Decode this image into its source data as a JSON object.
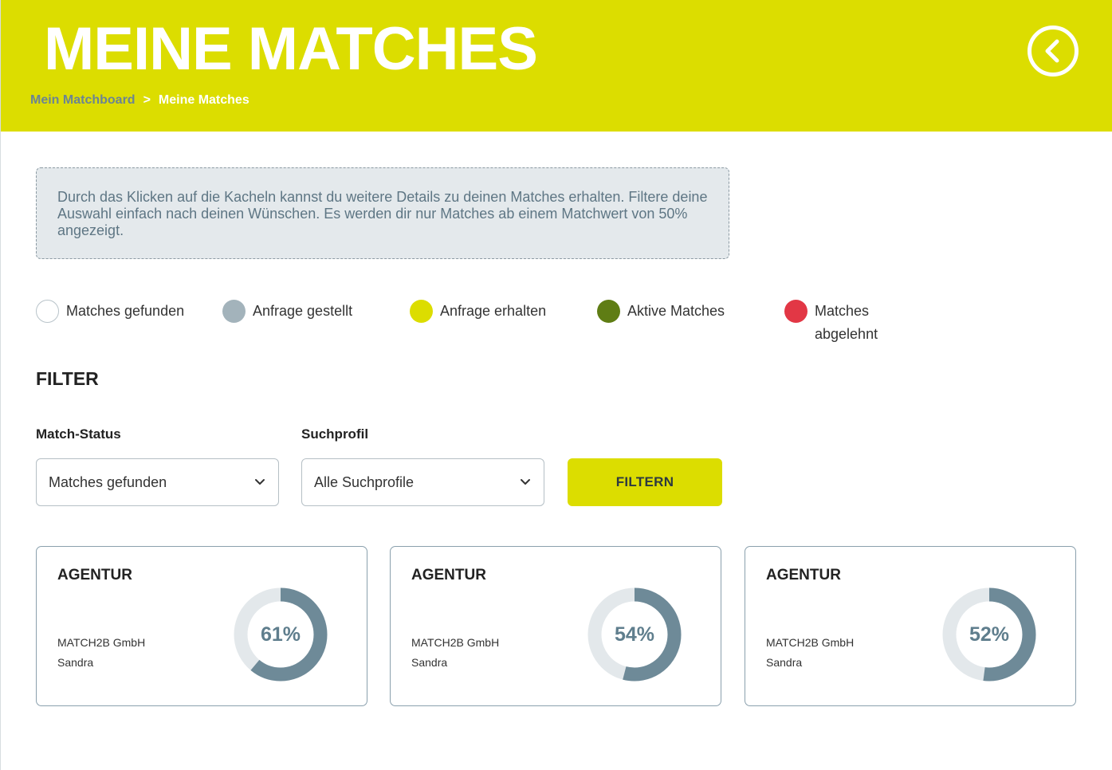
{
  "header": {
    "title": "MEINE MATCHES",
    "breadcrumb": {
      "parent": "Mein Matchboard",
      "separator": ">",
      "current": "Meine Matches"
    },
    "back_icon": "chevron-left-circle-icon"
  },
  "info": {
    "text": "Durch das Klicken auf die Kacheln kannst du weitere Details zu deinen Matches erhalten. Filtere deine Auswahl einfach nach deinen Wünschen. Es werden dir nur Matches ab einem Matchwert von 50% angezeigt."
  },
  "legend": [
    {
      "label": "Matches gefunden",
      "color": "#ffffff"
    },
    {
      "label": "Anfrage gestellt",
      "color": "#a3b3bb"
    },
    {
      "label": "Anfrage erhalten",
      "color": "#dcdd00"
    },
    {
      "label": "Aktive Matches",
      "color": "#5f7d14"
    },
    {
      "label": "Matches abgelehnt",
      "color": "#e23745"
    }
  ],
  "filter": {
    "title": "FILTER",
    "status_label": "Match-Status",
    "status_value": "Matches gefunden",
    "profile_label": "Suchprofil",
    "profile_value": "Alle Suchprofile",
    "button_label": "FILTERN"
  },
  "colors": {
    "accent": "#dcdd00",
    "donut_fill": "#6e8a98",
    "donut_track": "#e3e8eb"
  },
  "cards": [
    {
      "type": "AGENTUR",
      "company": "MATCH2B GmbH",
      "person": "Sandra",
      "percent": 61,
      "percent_label": "61%"
    },
    {
      "type": "AGENTUR",
      "company": "MATCH2B GmbH",
      "person": "Sandra",
      "percent": 54,
      "percent_label": "54%"
    },
    {
      "type": "AGENTUR",
      "company": "MATCH2B GmbH",
      "person": "Sandra",
      "percent": 52,
      "percent_label": "52%"
    }
  ]
}
